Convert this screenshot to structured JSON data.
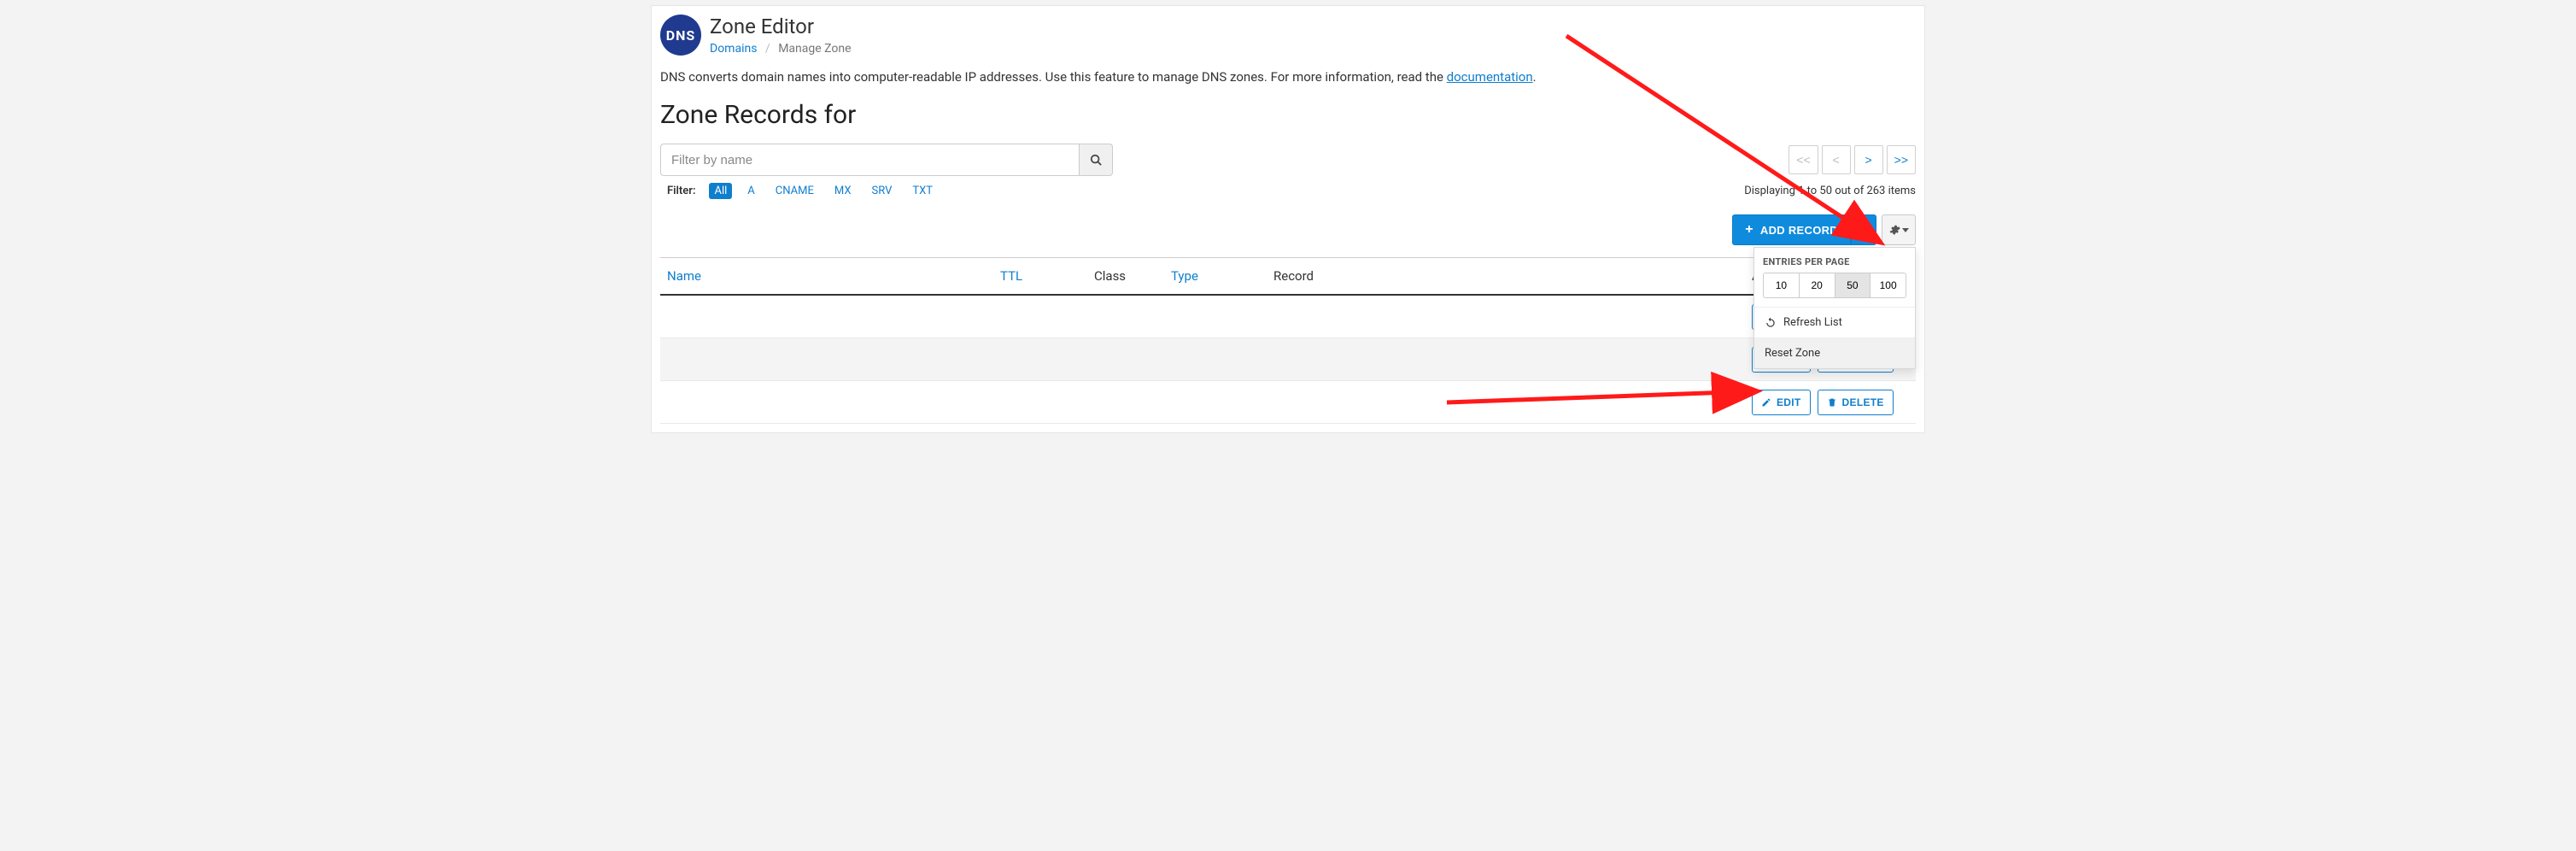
{
  "header": {
    "app_title": "Zone Editor",
    "breadcrumb_link": "Domains",
    "breadcrumb_current": "Manage Zone"
  },
  "description": {
    "text_before_link": "DNS converts domain names into computer-readable IP addresses. Use this feature to manage DNS zones. For more information, read the ",
    "link_text": "documentation",
    "text_after_link": "."
  },
  "zone_title": "Zone Records for",
  "search": {
    "placeholder": "Filter by name"
  },
  "pager": {
    "first": "<<",
    "prev": "<",
    "next": ">",
    "last": ">>"
  },
  "filter_label": "Filter:",
  "filter_chips": [
    "All",
    "A",
    "CNAME",
    "MX",
    "SRV",
    "TXT"
  ],
  "filter_active_index": 0,
  "display_count": "Displaying 1 to 50 out of 263 items",
  "toolbar": {
    "add_label": "ADD RECORD"
  },
  "gear_panel": {
    "entries_title": "ENTRIES PER PAGE",
    "entries_options": [
      "10",
      "20",
      "50",
      "100"
    ],
    "entries_active_index": 2,
    "refresh_label": "Refresh List",
    "reset_label": "Reset Zone"
  },
  "columns": {
    "name": "Name",
    "ttl": "TTL",
    "class": "Class",
    "type": "Type",
    "record": "Record",
    "actions": "Actions"
  },
  "row_buttons": {
    "edit": "EDIT",
    "delete": "DELETE"
  },
  "rows": [
    {
      "name": "",
      "ttl": "",
      "class": "",
      "type": "",
      "record": ""
    },
    {
      "name": "",
      "ttl": "",
      "class": "",
      "type": "",
      "record": ""
    },
    {
      "name": "",
      "ttl": "",
      "class": "",
      "type": "",
      "record": ""
    }
  ]
}
